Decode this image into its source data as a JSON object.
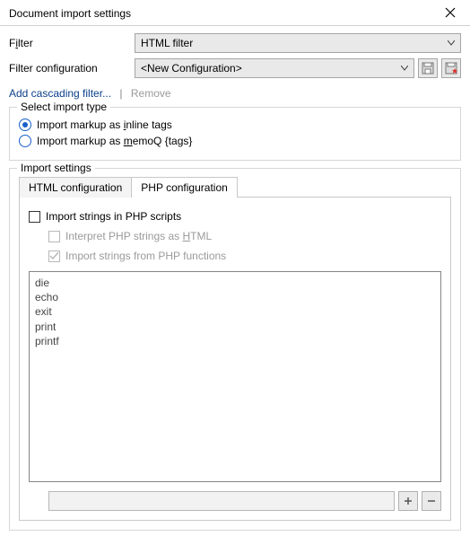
{
  "dialog": {
    "title": "Document import settings"
  },
  "filter": {
    "label_pre": "F",
    "label_u": "i",
    "label_post": "lter",
    "value": "HTML filter"
  },
  "filter_config": {
    "label": "Filter configuration",
    "value": "<New Configuration>"
  },
  "linkbar": {
    "add_cascading": "Add cascading filter...",
    "separator": "|",
    "remove": "Remove"
  },
  "import_type": {
    "legend": "Select import type",
    "opt1_pre": "Import markup as ",
    "opt1_u": "i",
    "opt1_post": "nline tags",
    "opt2_pre": "Import markup as ",
    "opt2_u": "m",
    "opt2_post": "emoQ {tags}"
  },
  "import_settings": {
    "legend": "Import settings",
    "tab_html": "HTML configuration",
    "tab_php": "PHP configuration"
  },
  "php": {
    "import_strings": "Import strings in PHP scripts",
    "interpret_pre": "Interpret PHP strings as ",
    "interpret_u": "H",
    "interpret_post": "TML",
    "import_funcs": "Import strings from PHP functions",
    "functions": [
      "die",
      "echo",
      "exit",
      "print",
      "printf"
    ]
  }
}
